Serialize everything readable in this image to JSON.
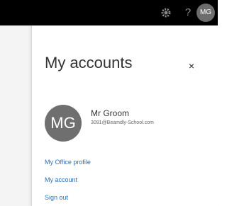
{
  "topbar": {
    "icons": [
      "gear-icon",
      "help-icon"
    ],
    "help_glyph": "?",
    "avatar_initials": "MG"
  },
  "panel": {
    "title": "My accounts",
    "close_glyph": "×"
  },
  "user": {
    "initials": "MG",
    "name": "Mr Groom",
    "email": "3091@Beamdly-School.com"
  },
  "links": {
    "office_profile": "My Office profile",
    "account": "My account",
    "sign_out": "Sign out"
  },
  "colors": {
    "topbar": "#000000",
    "avatar": "#6f6f6f",
    "link": "#2672c8"
  }
}
